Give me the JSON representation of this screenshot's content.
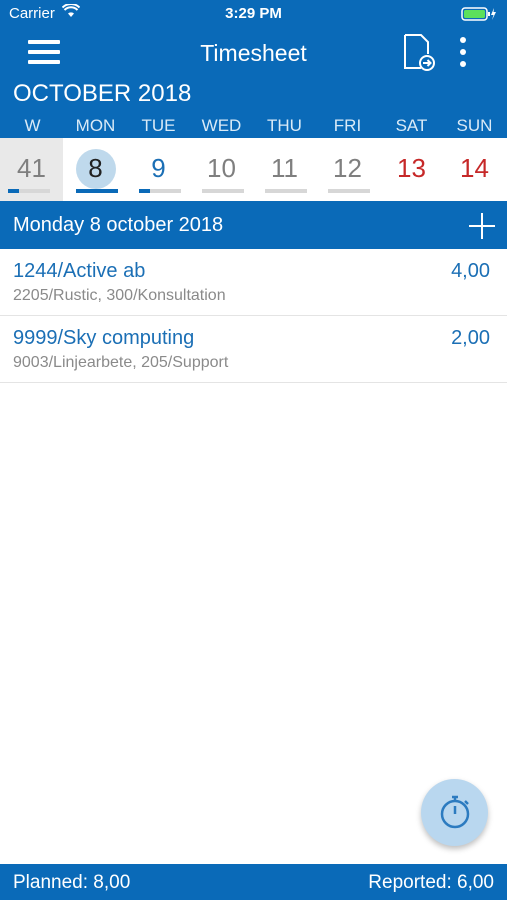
{
  "status_bar": {
    "carrier": "Carrier",
    "time": "3:29 PM"
  },
  "header": {
    "title": "Timesheet"
  },
  "calendar": {
    "month": "OCTOBER 2018",
    "day_names": [
      "W",
      "MON",
      "TUE",
      "WED",
      "THU",
      "FRI",
      "SAT",
      "SUN"
    ],
    "week_number": "41",
    "week_progress": 0.25,
    "days": [
      {
        "num": "8",
        "progress": 1.0,
        "selected": true
      },
      {
        "num": "9",
        "progress": 0.25,
        "selected": false
      },
      {
        "num": "10",
        "progress": 0,
        "selected": false
      },
      {
        "num": "11",
        "progress": 0,
        "selected": false
      },
      {
        "num": "12",
        "progress": 0,
        "selected": false
      },
      {
        "num": "13",
        "progress": null,
        "selected": false
      },
      {
        "num": "14",
        "progress": null,
        "selected": false
      }
    ]
  },
  "selected_date": "Monday 8 october 2018",
  "entries": [
    {
      "name": "1244/Active ab",
      "detail": "2205/Rustic, 300/Konsultation",
      "hours": "4,00"
    },
    {
      "name": "9999/Sky computing",
      "detail": "9003/Linjearbete, 205/Support",
      "hours": "2,00"
    }
  ],
  "footer": {
    "planned": "Planned: 8,00",
    "reported": "Reported: 6,00"
  },
  "colors": {
    "primary": "#0a6ab8",
    "link": "#1b6fb5",
    "weekend": "#c62828",
    "selected_day_bg": "#bfd9ec"
  },
  "icons": [
    "menu-icon",
    "export-document-icon",
    "more-vertical-icon",
    "plus-icon",
    "stopwatch-icon",
    "wifi-icon",
    "battery-icon"
  ]
}
